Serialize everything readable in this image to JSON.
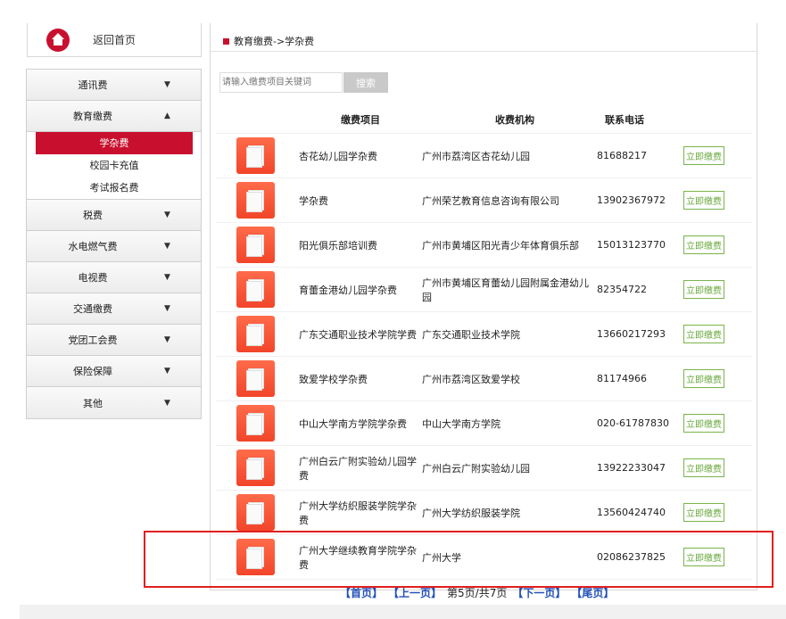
{
  "sidebar": {
    "home": "返回首页",
    "categories": [
      {
        "label": "通讯费",
        "arrow": "▼"
      },
      {
        "label": "教育缴费",
        "arrow": "▲",
        "sub": [
          "学杂费",
          "校园卡充值",
          "考试报名费"
        ]
      },
      {
        "label": "税费",
        "arrow": "▼"
      },
      {
        "label": "水电燃气费",
        "arrow": "▼"
      },
      {
        "label": "电视费",
        "arrow": "▼"
      },
      {
        "label": "交通缴费",
        "arrow": "▼"
      },
      {
        "label": "党团工会费",
        "arrow": "▼"
      },
      {
        "label": "保险保障",
        "arrow": "▼"
      },
      {
        "label": "其他",
        "arrow": "▼"
      }
    ]
  },
  "breadcrumb": "教育缴费->学杂费",
  "search": {
    "placeholder": "请输入缴费项目关键词",
    "button": "搜索"
  },
  "table": {
    "headers": [
      "缴费项目",
      "收费机构",
      "联系电话"
    ],
    "action_label": "立即缴费",
    "rows": [
      {
        "name": "杏花幼儿园学杂费",
        "org": "广州市荔湾区杏花幼儿园",
        "tel": "81688217"
      },
      {
        "name": "学杂费",
        "org": "广州荣艺教育信息咨询有限公司",
        "tel": "13902367972"
      },
      {
        "name": "阳光俱乐部培训费",
        "org": "广州市黄埔区阳光青少年体育俱乐部",
        "tel": "15013123770"
      },
      {
        "name": "育蕾金港幼儿园学杂费",
        "org": "广州市黄埔区育蕾幼儿园附属金港幼儿园",
        "tel": "82354722"
      },
      {
        "name": "广东交通职业技术学院学费",
        "org": "广东交通职业技术学院",
        "tel": "13660217293"
      },
      {
        "name": "致爱学校学杂费",
        "org": "广州市荔湾区致爱学校",
        "tel": "81174966"
      },
      {
        "name": "中山大学南方学院学杂费",
        "org": "中山大学南方学院",
        "tel": "020-61787830"
      },
      {
        "name": "广州白云广附实验幼儿园学费",
        "org": "广州白云广附实验幼儿园",
        "tel": "13922233047"
      },
      {
        "name": "广州大学纺织服装学院学杂费",
        "org": "广州大学纺织服装学院",
        "tel": "13560424740"
      },
      {
        "name": "广州大学继续教育学院学杂费",
        "org": "广州大学",
        "tel": "02086237825"
      }
    ]
  },
  "pager": {
    "first": "【首页】",
    "prev": "【上一页】",
    "status": "第5页/共7页",
    "next": "【下一页】",
    "last": "【尾页】"
  }
}
